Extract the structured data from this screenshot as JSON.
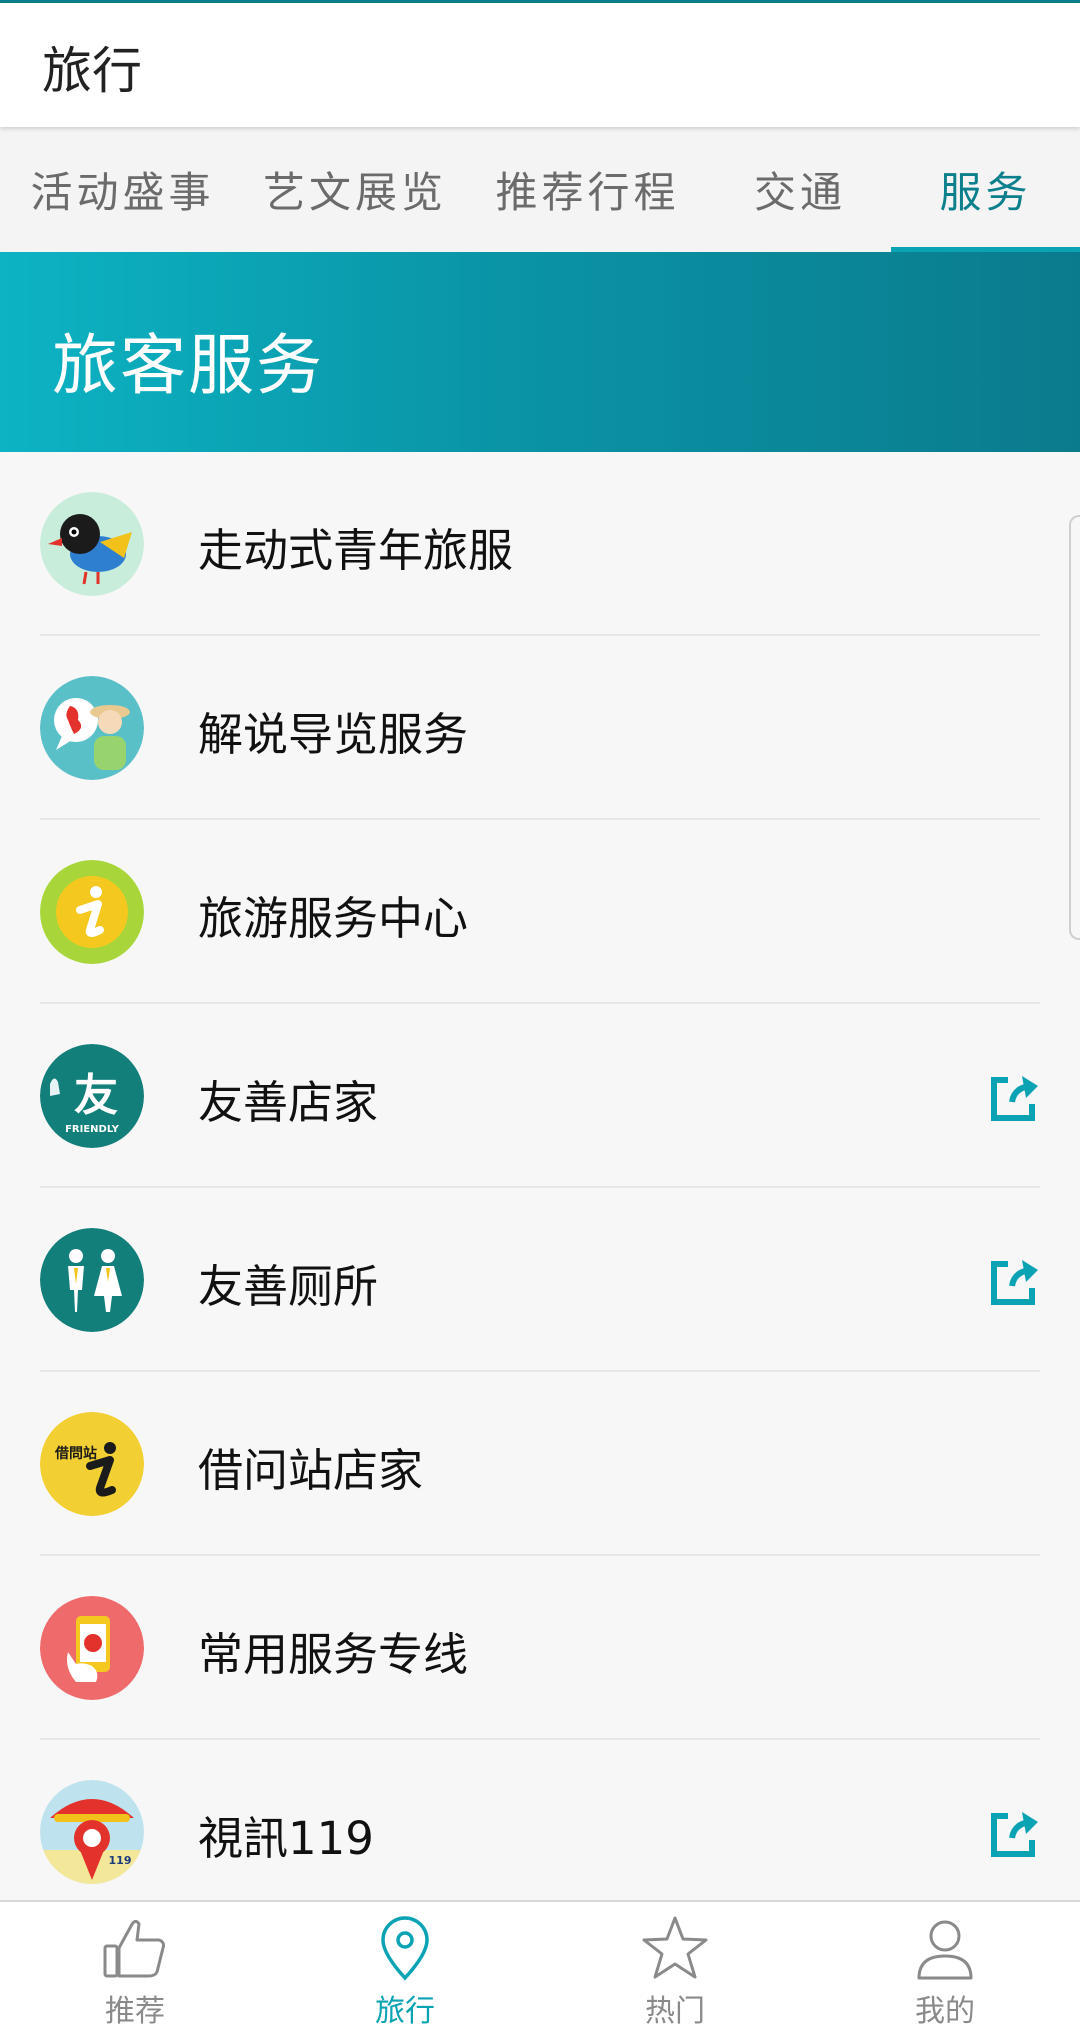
{
  "app": {
    "title": "旅行"
  },
  "tabs": [
    {
      "label": "活动盛事",
      "active": false
    },
    {
      "label": "艺文展览",
      "active": false
    },
    {
      "label": "推荐行程",
      "active": false
    },
    {
      "label": "交通",
      "active": false
    },
    {
      "label": "服务",
      "active": true
    }
  ],
  "banner": {
    "heading": "旅客服务"
  },
  "services": [
    {
      "label": "走动式青年旅服",
      "icon": "bird-mascot-icon",
      "external": false
    },
    {
      "label": "解说导览服务",
      "icon": "tour-guide-icon",
      "external": false
    },
    {
      "label": "旅游服务中心",
      "icon": "info-i-icon",
      "external": false
    },
    {
      "label": "友善店家",
      "icon": "friendly-shop-icon",
      "icon_text": "友",
      "icon_caption": "FRIENDLY",
      "external": true
    },
    {
      "label": "友善厕所",
      "icon": "restroom-icon",
      "external": true
    },
    {
      "label": "借问站店家",
      "icon": "inquiry-station-icon",
      "icon_text": "借問站",
      "external": false
    },
    {
      "label": "常用服务专线",
      "icon": "phone-hotline-icon",
      "external": false
    },
    {
      "label": "視訊119",
      "icon": "video-119-icon",
      "icon_text": "119",
      "external": true
    }
  ],
  "bottom_nav": [
    {
      "label": "推荐",
      "icon": "thumbs-up-icon",
      "active": false
    },
    {
      "label": "旅行",
      "icon": "location-pin-icon",
      "active": true
    },
    {
      "label": "热门",
      "icon": "star-icon",
      "active": false
    },
    {
      "label": "我的",
      "icon": "person-icon",
      "active": false
    }
  ],
  "colors": {
    "accent": "#0aa3b3",
    "accent_dark": "#0b7f8c",
    "banner_start": "#0cb3c3",
    "banner_end": "#0a7b8d"
  }
}
